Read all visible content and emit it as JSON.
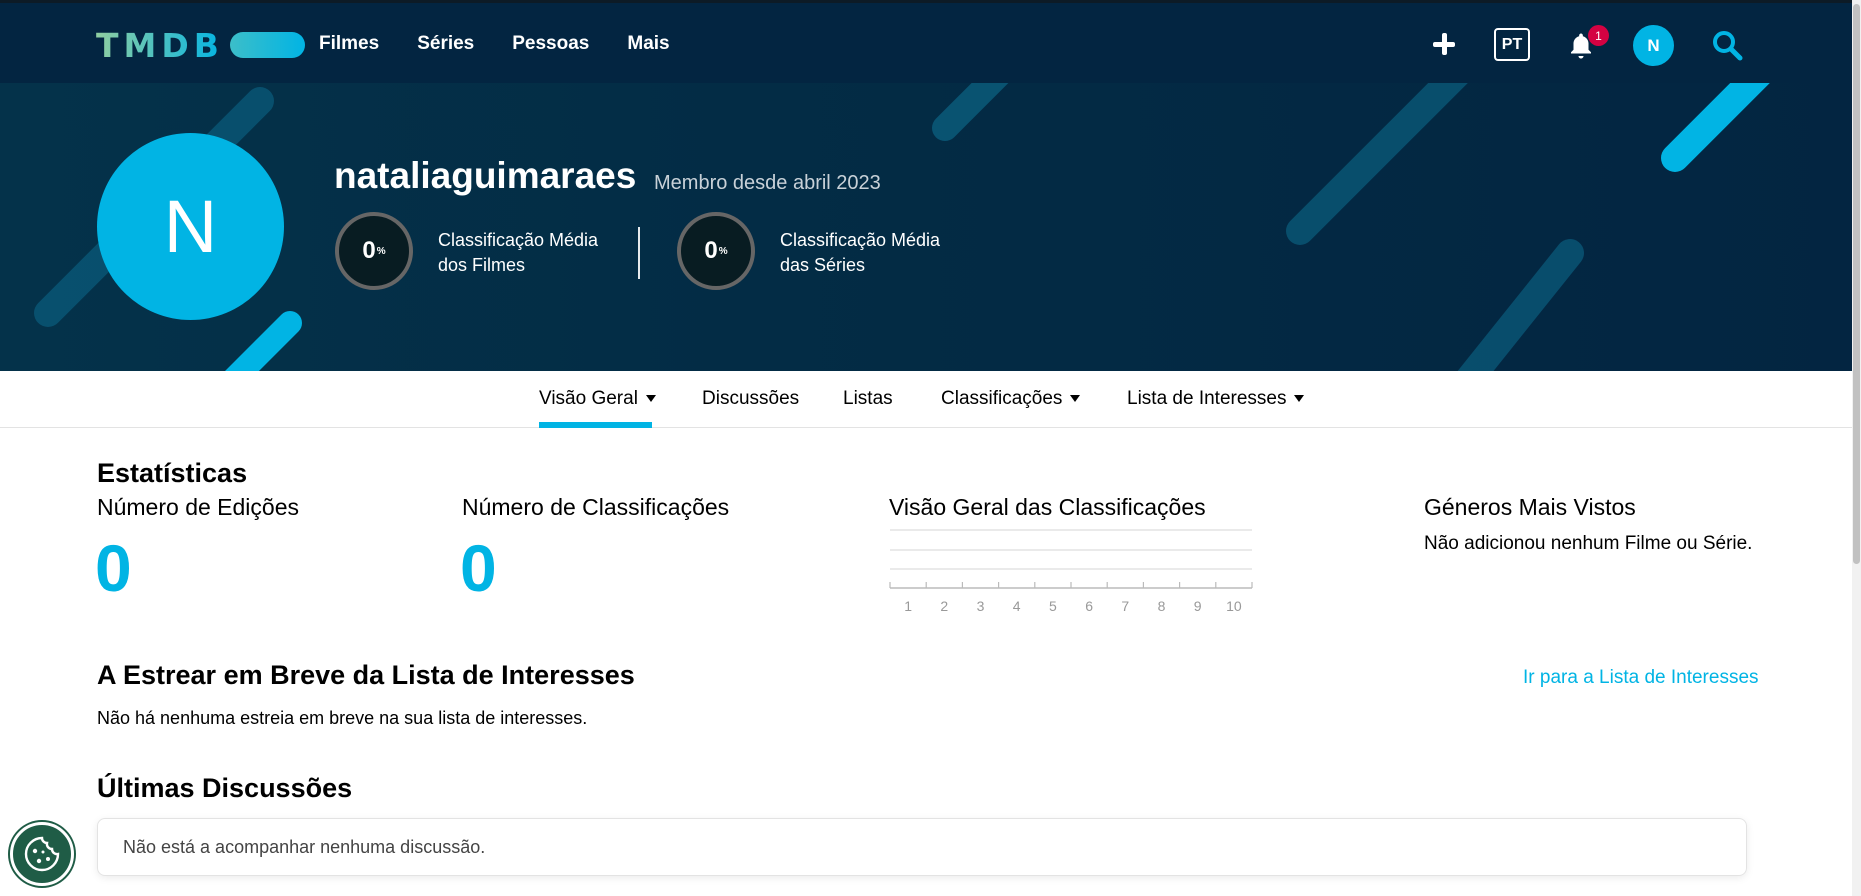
{
  "header": {
    "logo": "TMDB",
    "nav": [
      "Filmes",
      "Séries",
      "Pessoas",
      "Mais"
    ],
    "lang": "PT",
    "notif_count": "1",
    "avatar_initial": "N",
    "icons": [
      "plus-icon",
      "bell-icon",
      "search-icon"
    ]
  },
  "profile": {
    "initial": "N",
    "username": "nataliaguimaraes",
    "member_since": "Membro desde abril 2023",
    "movie_score": "0",
    "movie_score_label_1": "Classificação Média",
    "movie_score_label_2": "dos Filmes",
    "tv_score": "0",
    "tv_score_label_1": "Classificação Média",
    "tv_score_label_2": "das Séries",
    "percent_symbol": "%"
  },
  "subnav": {
    "overview": "Visão Geral",
    "discussions": "Discussões",
    "lists": "Listas",
    "ratings": "Classificações",
    "watchlist": "Lista de Interesses"
  },
  "stats": {
    "title": "Estatísticas",
    "edits_label": "Número de Edições",
    "edits_value": "0",
    "ratings_label": "Número de Classificações",
    "ratings_value": "0",
    "overview_label": "Visão Geral das Classificações",
    "chart_ticks": [
      "1",
      "2",
      "3",
      "4",
      "5",
      "6",
      "7",
      "8",
      "9",
      "10"
    ],
    "genres_label": "Géneros Mais Vistos",
    "genres_empty": "Não adicionou nenhum Filme ou Série."
  },
  "upcoming": {
    "title": "A Estrear em Breve da Lista de Interesses",
    "link": "Ir para a Lista de Interesses",
    "empty": "Não há nenhuma estreia em breve na sua lista de interesses."
  },
  "discussions": {
    "title": "Últimas Discussões",
    "empty": "Não está a acompanhar nenhuma discussão."
  },
  "colors": {
    "primary": "#032541",
    "accent": "#01b4e4",
    "badge": "#d40242",
    "cookie": "#1f5c46"
  }
}
